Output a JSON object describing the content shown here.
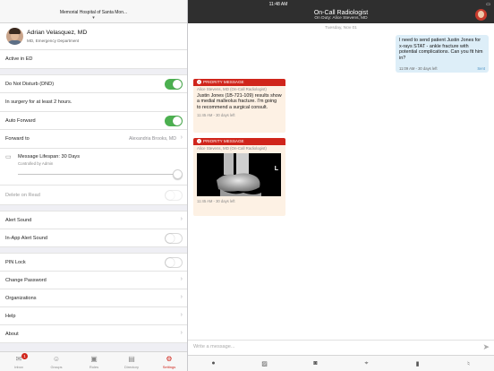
{
  "left": {
    "hospital": "Memorial Hospital of Santa Mon...",
    "profile": {
      "name": "Adrian Velasquez, MD",
      "role": "MD, Emergency Department"
    },
    "status_text": "Active in ED",
    "dnd": {
      "label": "Do Not Disturb (DND)",
      "on": true,
      "note": "In surgery for at least 2 hours."
    },
    "auto_forward": {
      "label": "Auto Forward",
      "on": true
    },
    "forward_to": {
      "label": "Forward to",
      "value": "Alexandria Brooks, MD"
    },
    "lifespan": {
      "label": "Message Lifespan: 30 Days",
      "sub": "Controlled by Admin",
      "level": 1.0
    },
    "delete_on_read": {
      "label": "Delete on Read",
      "on": false
    },
    "alert_sound": "Alert Sound",
    "in_app_alert": {
      "label": "In-App Alert Sound",
      "on": false
    },
    "pin_lock": {
      "label": "PIN Lock",
      "on": false
    },
    "change_password": "Change Password",
    "organizations": "Organizations",
    "help": "Help",
    "about": "About",
    "tabs": [
      {
        "label": "Inbox",
        "icon": "inbox-icon",
        "badge": "1"
      },
      {
        "label": "Groups",
        "icon": "groups-icon"
      },
      {
        "label": "Roles",
        "icon": "roles-icon"
      },
      {
        "label": "Directory",
        "icon": "directory-icon"
      },
      {
        "label": "Settings",
        "icon": "gear-icon"
      }
    ]
  },
  "right": {
    "status_time": "11:48 AM",
    "title": "On-Call Radiologist",
    "subtitle": "On Duty: Alice Stevens, MD",
    "date": "Tuesday, Nov 01",
    "outgoing": {
      "text": "I need to send patient Justin Jones for x-rays STAT - ankle fracture with potential complications. Can you fit him in?",
      "meta": "11:09 AM - 30 days left",
      "status": "Sent"
    },
    "priority_messages": [
      {
        "header": "PRIORITY MESSAGE",
        "from": "Alice Stevens, MD (On-Call Radiologist)",
        "text": "Justin Jones (1B-721-109) results show a medial malleolus fracture. I'm going to recommend a surgical consult.",
        "meta": "11:45 AM - 30 days left"
      },
      {
        "header": "PRIORITY MESSAGE",
        "from": "Alice Stevens, MD (On-Call Radiologist)",
        "image_marker": "L",
        "meta": "11:45 AM - 30 days left"
      }
    ],
    "compose_placeholder": "Write a message...",
    "attach_icons": [
      "alert-icon",
      "image-icon",
      "camera-icon",
      "location-icon",
      "document-icon",
      "microphone-icon"
    ]
  }
}
